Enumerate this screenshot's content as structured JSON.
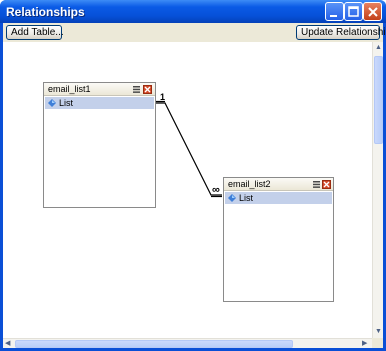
{
  "window": {
    "title": "Relationships"
  },
  "toolbar": {
    "add_table_label": "Add Table...",
    "update_label": "Update Relationships"
  },
  "tables": [
    {
      "name": "email_list1",
      "field": "List"
    },
    {
      "name": "email_list2",
      "field": "List"
    }
  ],
  "relationship": {
    "from_cardinality": "1",
    "to_cardinality": "∞"
  },
  "colors": {
    "titlebar": "#0650d8",
    "client_bg": "#ece9d8",
    "field_highlight": "#c3d0ea"
  }
}
